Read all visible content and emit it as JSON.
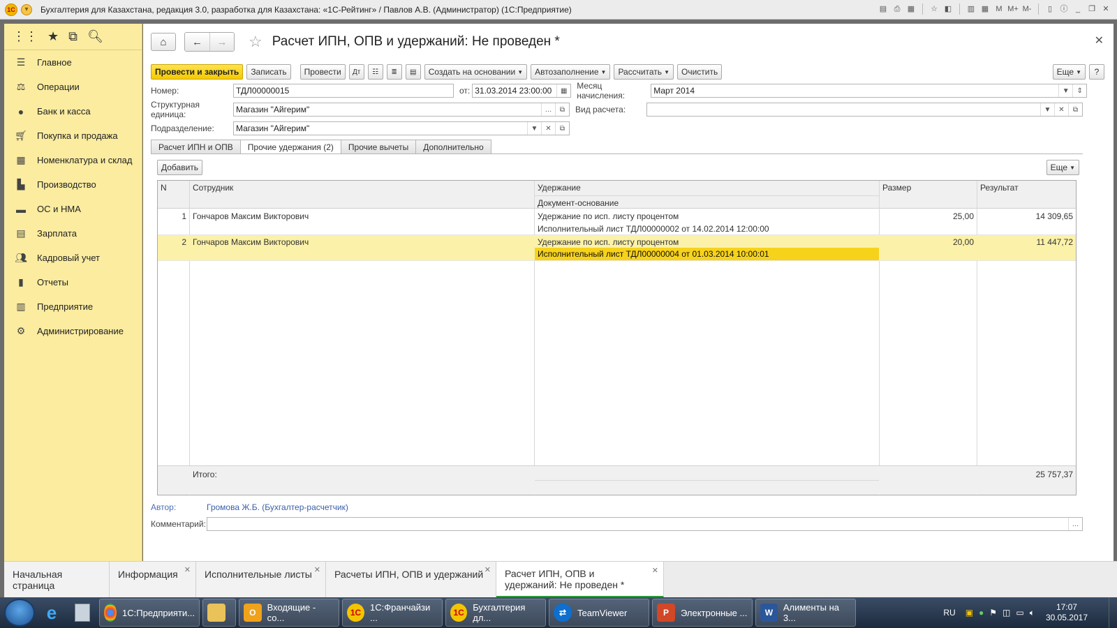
{
  "window": {
    "title": "Бухгалтерия для Казахстана, редакция 3.0, разработка для Казахстана: «1С-Рейтинг» / Павлов А.В. (Администратор)  (1С:Предприятие)"
  },
  "toolbar_icons": {
    "m": "M",
    "mplus": "M+",
    "mminus": "M-"
  },
  "sidebar": {
    "items": [
      {
        "label": "Главное",
        "icon": "menu-icon"
      },
      {
        "label": "Операции",
        "icon": "operations-icon"
      },
      {
        "label": "Банк и касса",
        "icon": "bank-icon"
      },
      {
        "label": "Покупка и продажа",
        "icon": "cart-icon"
      },
      {
        "label": "Номенклатура и склад",
        "icon": "warehouse-icon"
      },
      {
        "label": "Производство",
        "icon": "factory-icon"
      },
      {
        "label": "ОС и НМА",
        "icon": "truck-icon"
      },
      {
        "label": "Зарплата",
        "icon": "salary-icon"
      },
      {
        "label": "Кадровый учет",
        "icon": "people-icon"
      },
      {
        "label": "Отчеты",
        "icon": "chart-icon"
      },
      {
        "label": "Предприятие",
        "icon": "enterprise-icon"
      },
      {
        "label": "Администрирование",
        "icon": "gear-icon"
      }
    ]
  },
  "document": {
    "title": "Расчет ИПН, ОПВ и удержаний: Не проведен *",
    "buttons": {
      "post_close": "Провести и закрыть",
      "save": "Записать",
      "post": "Провести",
      "create_based": "Создать на основании",
      "autofill": "Автозаполнение",
      "calculate": "Рассчитать",
      "clear": "Очистить",
      "more": "Еще",
      "help": "?"
    },
    "fields": {
      "number_label": "Номер:",
      "number": "ТДЛ00000015",
      "date_label": "от:",
      "date": "31.03.2014 23:00:00",
      "month_label": "Месяц начисления:",
      "month": "Март 2014",
      "unit_label": "Структурная единица:",
      "unit": "Магазин \"Айгерим\"",
      "calc_type_label": "Вид расчета:",
      "calc_type": "",
      "division_label": "Подразделение:",
      "division": "Магазин \"Айгерим\""
    },
    "tabs": [
      "Расчет ИПН и ОПВ",
      "Прочие удержания (2)",
      "Прочие вычеты",
      "Дополнительно"
    ],
    "active_tab": 1,
    "add_button": "Добавить",
    "more2": "Еще",
    "table": {
      "headers": {
        "n": "N",
        "employee": "Сотрудник",
        "deduction": "Удержание",
        "basis": "Документ-основание",
        "size": "Размер",
        "result": "Результат"
      },
      "rows": [
        {
          "n": "1",
          "employee": "Гончаров Максим Викторович",
          "deduction": "Удержание по исп. листу процентом",
          "basis": "Исполнительный лист ТДЛ00000002 от 14.02.2014 12:00:00",
          "size": "25,00",
          "result": "14 309,65"
        },
        {
          "n": "2",
          "employee": "Гончаров Максим Викторович",
          "deduction": "Удержание по исп. листу процентом",
          "basis": "Исполнительный лист ТДЛ00000004 от 01.03.2014 10:00:01",
          "size": "20,00",
          "result": "11 447,72"
        }
      ],
      "total_label": "Итого:",
      "total": "25 757,37"
    },
    "author_label": "Автор:",
    "author": "Громова Ж.Б. (Бухгалтер-расчетчик)",
    "comment_label": "Комментарий:",
    "comment": ""
  },
  "window_tabs": [
    {
      "label": "Начальная страница",
      "close": false
    },
    {
      "label": "Информация",
      "close": true
    },
    {
      "label": "Исполнительные листы",
      "close": true
    },
    {
      "label": "Расчеты ИПН, ОПВ и удержаний",
      "close": true
    },
    {
      "label": "Расчет ИПН, ОПВ и удержаний: Не проведен *",
      "close": true,
      "active": true
    }
  ],
  "taskbar": {
    "items": [
      {
        "label": "1С:Предприяти...",
        "icon": "chrome-icon"
      },
      {
        "label": "",
        "icon": "folder-icon"
      },
      {
        "label": "Входящие - со...",
        "icon": "outlook-icon"
      },
      {
        "label": "1С:Франчайзи ...",
        "icon": "onec-icon"
      },
      {
        "label": "Бухгалтерия дл...",
        "icon": "onec-icon"
      },
      {
        "label": "TeamViewer",
        "icon": "teamviewer-icon"
      },
      {
        "label": "Электронные ...",
        "icon": "powerpoint-icon"
      },
      {
        "label": "Алименты на 3...",
        "icon": "word-icon"
      }
    ],
    "lang": "RU",
    "time": "17:07",
    "date": "30.05.2017"
  }
}
